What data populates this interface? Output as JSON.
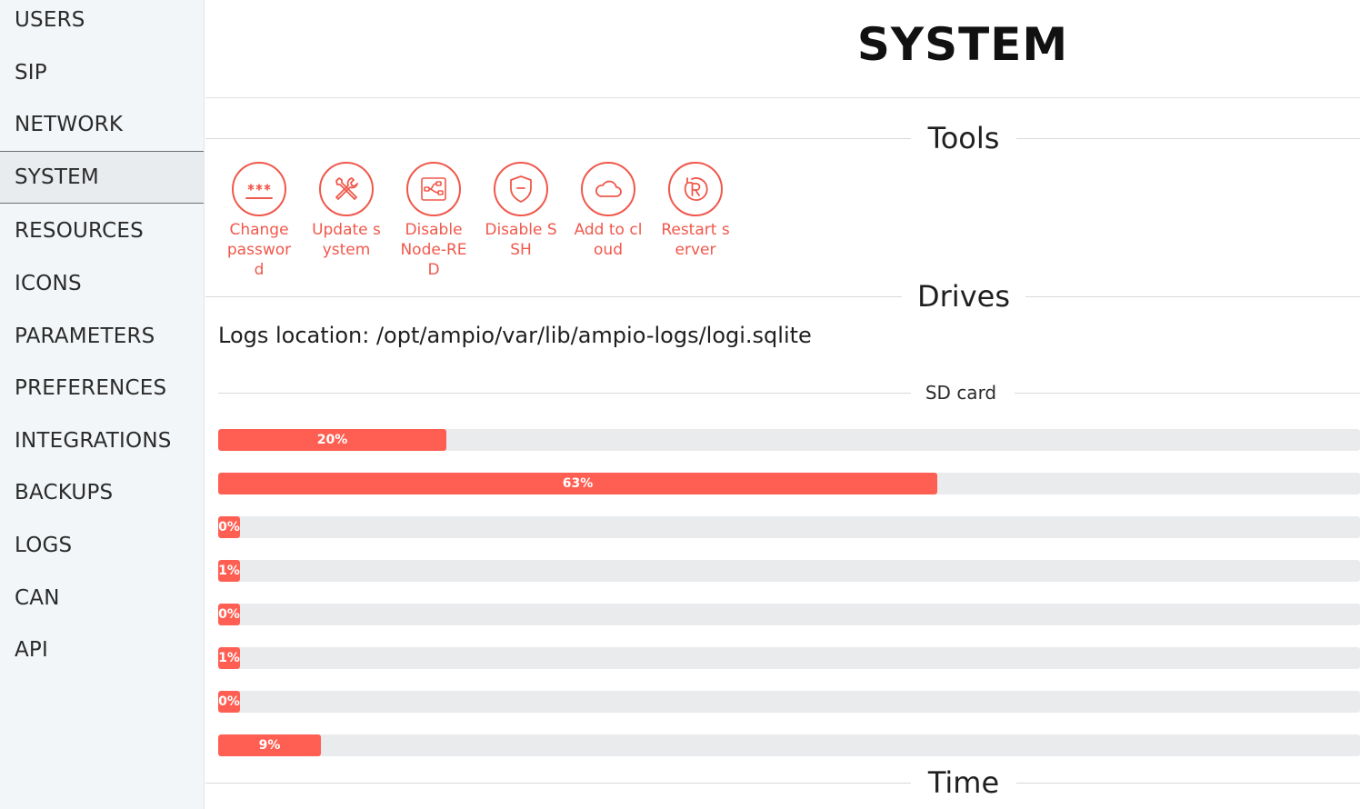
{
  "sidebar": {
    "items": [
      {
        "label": "USERS"
      },
      {
        "label": "SIP"
      },
      {
        "label": "NETWORK"
      },
      {
        "label": "SYSTEM",
        "active": true
      },
      {
        "label": "RESOURCES"
      },
      {
        "label": "ICONS"
      },
      {
        "label": "PARAMETERS"
      },
      {
        "label": "PREFERENCES"
      },
      {
        "label": "INTEGRATIONS"
      },
      {
        "label": "BACKUPS"
      },
      {
        "label": "LOGS"
      },
      {
        "label": "CAN"
      },
      {
        "label": "API"
      }
    ]
  },
  "page": {
    "title": "SYSTEM"
  },
  "sections": {
    "tools": "Tools",
    "drives": "Drives",
    "time": "Time"
  },
  "tools": [
    {
      "label": "Change password",
      "icon": "password-icon"
    },
    {
      "label": "Update system",
      "icon": "wrench-screwdriver-icon"
    },
    {
      "label": "Disable Node-RED",
      "icon": "node-red-icon"
    },
    {
      "label": "Disable SSH",
      "icon": "shield-icon"
    },
    {
      "label": "Add to cloud",
      "icon": "cloud-icon"
    },
    {
      "label": "Restart server",
      "icon": "restart-icon"
    }
  ],
  "drives": {
    "logs_location": "Logs location: /opt/ampio/var/lib/ampio-logs/logi.sqlite",
    "sd_card_label": "SD card",
    "bars": [
      {
        "value": 20,
        "label": "20%"
      },
      {
        "value": 63,
        "label": "63%"
      },
      {
        "value": 0,
        "label": "0%"
      },
      {
        "value": 1,
        "label": "1%"
      },
      {
        "value": 0,
        "label": "0%"
      },
      {
        "value": 1,
        "label": "1%"
      },
      {
        "value": 0,
        "label": "0%"
      },
      {
        "value": 9,
        "label": "9%"
      }
    ]
  },
  "colors": {
    "accent": "#ff5f52",
    "icon_red": "#f0584b",
    "bar_track": "#e9ebed",
    "sidebar_bg": "#f3f6f8"
  }
}
